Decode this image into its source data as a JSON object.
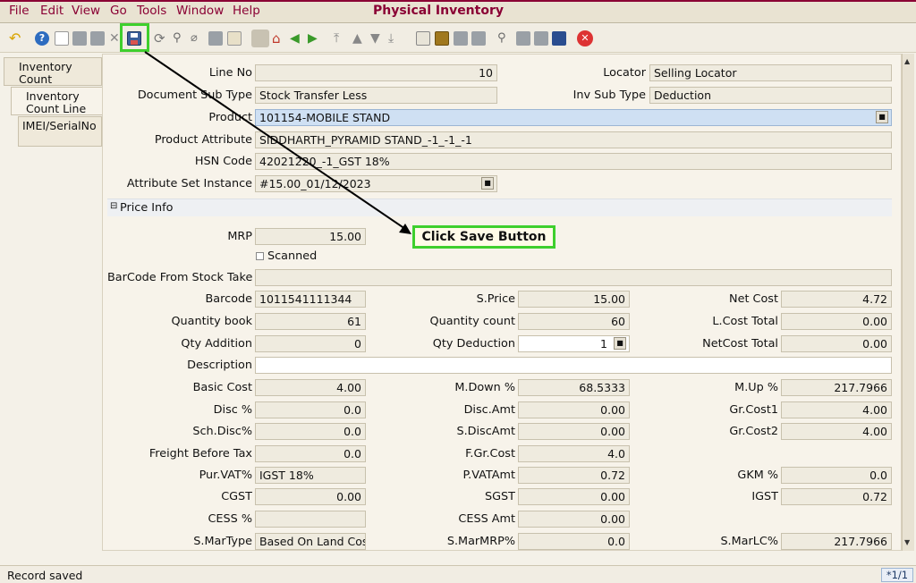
{
  "menu": {
    "file": "File",
    "edit": "Edit",
    "view": "View",
    "go": "Go",
    "tools": "Tools",
    "window": "Window",
    "help": "Help"
  },
  "window_title": "Physical Inventory",
  "tabs": [
    "Inventory Count",
    "Inventory Count Line",
    "IMEI/SerialNo"
  ],
  "form": {
    "line_no": {
      "label": "Line No",
      "value": "10"
    },
    "locator": {
      "label": "Locator",
      "value": "Selling Locator"
    },
    "doc_sub_type": {
      "label": "Document Sub Type",
      "value": "Stock Transfer Less"
    },
    "inv_sub_type": {
      "label": "Inv Sub Type",
      "value": "Deduction"
    },
    "product": {
      "label": "Product",
      "value": "101154-MOBILE STAND"
    },
    "product_attribute": {
      "label": "Product Attribute",
      "value": "SIDDHARTH_PYRAMID STAND_-1_-1_-1"
    },
    "hsn_code": {
      "label": "HSN Code",
      "value": "42021220_-1_GST 18%"
    },
    "attr_set_instance": {
      "label": "Attribute Set Instance",
      "value": "#15.00_01/12/2023"
    },
    "price_info": "Price Info",
    "mrp": {
      "label": "MRP",
      "value": "15.00"
    },
    "scanned": {
      "label": "Scanned",
      "checked": false
    },
    "barcode_from_stock_take": {
      "label": "BarCode From Stock Take",
      "value": ""
    },
    "barcode": {
      "label": "Barcode",
      "value": "1011541111344"
    },
    "s_price": {
      "label": "S.Price",
      "value": "15.00"
    },
    "net_cost": {
      "label": "Net Cost",
      "value": "4.72"
    },
    "qty_book": {
      "label": "Quantity book",
      "value": "61"
    },
    "qty_count": {
      "label": "Quantity count",
      "value": "60"
    },
    "l_cost_total": {
      "label": "L.Cost Total",
      "value": "0.00"
    },
    "qty_addition": {
      "label": "Qty Addition",
      "value": "0"
    },
    "qty_deduction": {
      "label": "Qty Deduction",
      "value": "1"
    },
    "netcost_total": {
      "label": "NetCost Total",
      "value": "0.00"
    },
    "description": {
      "label": "Description",
      "value": ""
    },
    "basic_cost": {
      "label": "Basic Cost",
      "value": "4.00"
    },
    "m_down": {
      "label": "M.Down %",
      "value": "68.5333"
    },
    "m_up": {
      "label": "M.Up %",
      "value": "217.7966"
    },
    "disc_pct": {
      "label": "Disc %",
      "value": "0.0"
    },
    "disc_amt": {
      "label": "Disc.Amt",
      "value": "0.00"
    },
    "gr_cost1": {
      "label": "Gr.Cost1",
      "value": "4.00"
    },
    "sch_disc": {
      "label": "Sch.Disc%",
      "value": "0.0"
    },
    "s_disc_amt": {
      "label": "S.DiscAmt",
      "value": "0.00"
    },
    "gr_cost2": {
      "label": "Gr.Cost2",
      "value": "4.00"
    },
    "freight": {
      "label": "Freight Before Tax",
      "value": "0.0"
    },
    "f_gr_cost": {
      "label": "F.Gr.Cost",
      "value": "4.0"
    },
    "pur_vat": {
      "label": "Pur.VAT%",
      "value": "IGST 18%"
    },
    "p_vat_amt": {
      "label": "P.VATAmt",
      "value": "0.72"
    },
    "gkm": {
      "label": "GKM %",
      "value": "0.0"
    },
    "cgst": {
      "label": "CGST",
      "value": "0.00"
    },
    "sgst": {
      "label": "SGST",
      "value": "0.00"
    },
    "igst": {
      "label": "IGST",
      "value": "0.72"
    },
    "cess_pct": {
      "label": "CESS %",
      "value": ""
    },
    "cess_amt": {
      "label": "CESS Amt",
      "value": "0.00"
    },
    "s_mar_type": {
      "label": "S.MarType",
      "value": "Based On Land Cost"
    },
    "s_mar_mrp": {
      "label": "S.MarMRP%",
      "value": "0.0"
    },
    "s_mar_lc": {
      "label": "S.MarLC%",
      "value": "217.7966"
    }
  },
  "callout": "Click Save Button",
  "status": {
    "message": "Record saved",
    "page": "*1/1"
  },
  "colors": {
    "accent": "#8a0034",
    "highlight": "#3ecf2d"
  }
}
